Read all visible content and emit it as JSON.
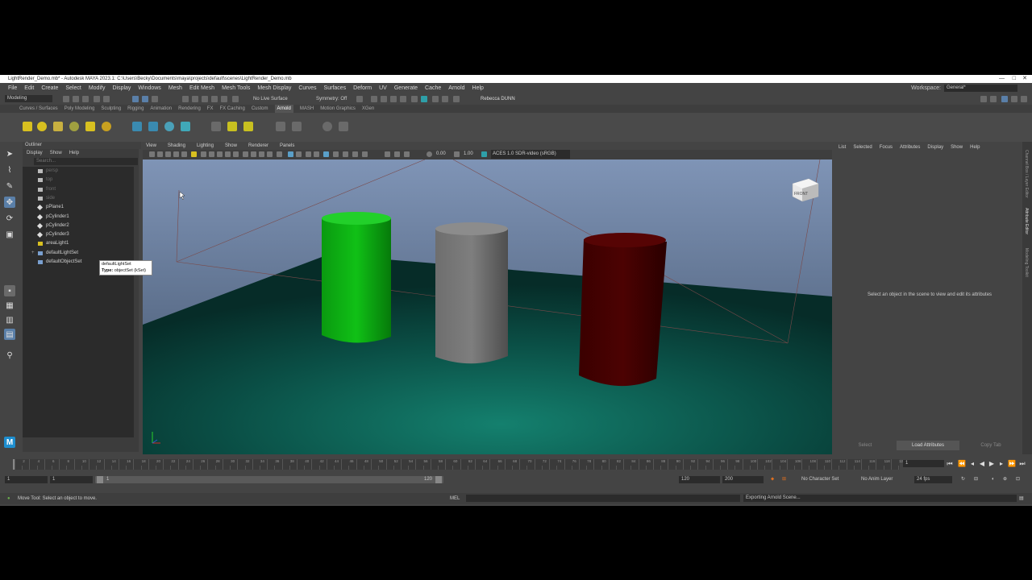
{
  "title": "LightRender_Demo.mb* - Autodesk MAYA 2023.1: C:\\Users\\Becky\\Documents\\maya\\projects\\default\\scenes\\LightRender_Demo.mb",
  "window_controls": [
    "—",
    "□",
    "✕"
  ],
  "menu": [
    "File",
    "Edit",
    "Create",
    "Select",
    "Modify",
    "Display",
    "Windows",
    "Mesh",
    "Edit Mesh",
    "Mesh Tools",
    "Mesh Display",
    "Curves",
    "Surfaces",
    "Deform",
    "UV",
    "Generate",
    "Cache",
    "Arnold",
    "Help"
  ],
  "workspace": {
    "label": "Workspace:",
    "value": "General*"
  },
  "status": {
    "mode": "Modeling",
    "live_surface": "No Live Surface",
    "symmetry": "Symmetry: Off",
    "user": "Rebecca DUNN"
  },
  "shelf_tabs": [
    "Curves / Surfaces",
    "Poly Modeling",
    "Sculpting",
    "Rigging",
    "Animation",
    "Rendering",
    "FX",
    "FX Caching",
    "Custom",
    "Arnold",
    "MASH",
    "Motion Graphics",
    "XGen"
  ],
  "shelf_active": "Arnold",
  "outliner": {
    "title": "Outliner",
    "menu": [
      "Display",
      "Show",
      "Help"
    ],
    "search_placeholder": "Search...",
    "items": [
      {
        "name": "persp",
        "dim": true,
        "icon": "camera-icon"
      },
      {
        "name": "top",
        "dim": true,
        "icon": "camera-icon"
      },
      {
        "name": "front",
        "dim": true,
        "icon": "camera-icon"
      },
      {
        "name": "side",
        "dim": true,
        "icon": "camera-icon"
      },
      {
        "name": "pPlane1",
        "dim": false,
        "icon": "mesh-icon"
      },
      {
        "name": "pCylinder1",
        "dim": false,
        "icon": "mesh-icon"
      },
      {
        "name": "pCylinder2",
        "dim": false,
        "icon": "mesh-icon"
      },
      {
        "name": "pCylinder3",
        "dim": false,
        "icon": "mesh-icon"
      },
      {
        "name": "areaLight1",
        "dim": false,
        "icon": "light-icon"
      },
      {
        "name": "defaultLightSet",
        "dim": false,
        "icon": "set-icon",
        "expand": "+"
      },
      {
        "name": "defaultObjectSet",
        "dim": false,
        "icon": "set-icon"
      }
    ],
    "tooltip": {
      "line1": "defaultLightSet",
      "type_label": "Type:",
      "type_value": "objectSet (kSet)"
    }
  },
  "viewport": {
    "menu": [
      "View",
      "Shading",
      "Lighting",
      "Show",
      "Renderer",
      "Panels"
    ],
    "exposure": "0.00",
    "gamma": "1.00",
    "colorspace": "ACES 1.0 SDR-video (sRGB)",
    "viewcube": "FRONT"
  },
  "attribute_editor": {
    "menu": [
      "List",
      "Selected",
      "Focus",
      "Attributes",
      "Display",
      "Show",
      "Help"
    ],
    "message": "Select an object in the scene to view and edit its attributes",
    "buttons": [
      "Select",
      "Load Attributes",
      "Copy Tab"
    ],
    "side_tabs": [
      "Channel Box / Layer Editor",
      "Attribute Editor",
      "Modeling Toolkit"
    ]
  },
  "timeline": {
    "ticks": [
      "1",
      "2",
      "3",
      "4",
      "5",
      "6",
      "7",
      "8",
      "9",
      "10",
      "11",
      "12",
      "13",
      "14",
      "15",
      "16",
      "17",
      "18",
      "19",
      "20",
      "21",
      "22",
      "23",
      "24",
      "25",
      "26",
      "27",
      "28",
      "29",
      "30",
      "31",
      "32",
      "33",
      "34",
      "35",
      "36",
      "37",
      "38",
      "39",
      "40",
      "41",
      "42",
      "43",
      "44",
      "45",
      "46",
      "47",
      "48",
      "49",
      "50",
      "51",
      "52",
      "53",
      "54",
      "55",
      "56",
      "57",
      "58",
      "59",
      "60",
      "61",
      "62",
      "63",
      "64",
      "65",
      "66",
      "67",
      "68",
      "69",
      "70",
      "71",
      "72",
      "73",
      "74",
      "75",
      "76",
      "77",
      "78",
      "79",
      "80",
      "81",
      "82",
      "83",
      "84",
      "85",
      "86",
      "87",
      "88",
      "89",
      "90",
      "91",
      "92",
      "93",
      "94",
      "95",
      "96",
      "97",
      "98",
      "99",
      "100",
      "101",
      "102",
      "103",
      "104",
      "105",
      "106",
      "107",
      "108",
      "109",
      "110",
      "111",
      "112",
      "113",
      "114",
      "115",
      "116",
      "117",
      "118",
      "119",
      "120"
    ],
    "current_frame": "1"
  },
  "range": {
    "start": "1",
    "anim_start": "1",
    "bar_start": "1",
    "bar_end": "120",
    "end": "120",
    "anim_end": "200",
    "character_set": "No Character Set",
    "anim_layer": "No Anim Layer",
    "fps": "24 fps"
  },
  "help_line": {
    "text": "Move Tool: Select an object to move.",
    "mel": "MEL",
    "result": "Exporting Arnold Scene..."
  }
}
